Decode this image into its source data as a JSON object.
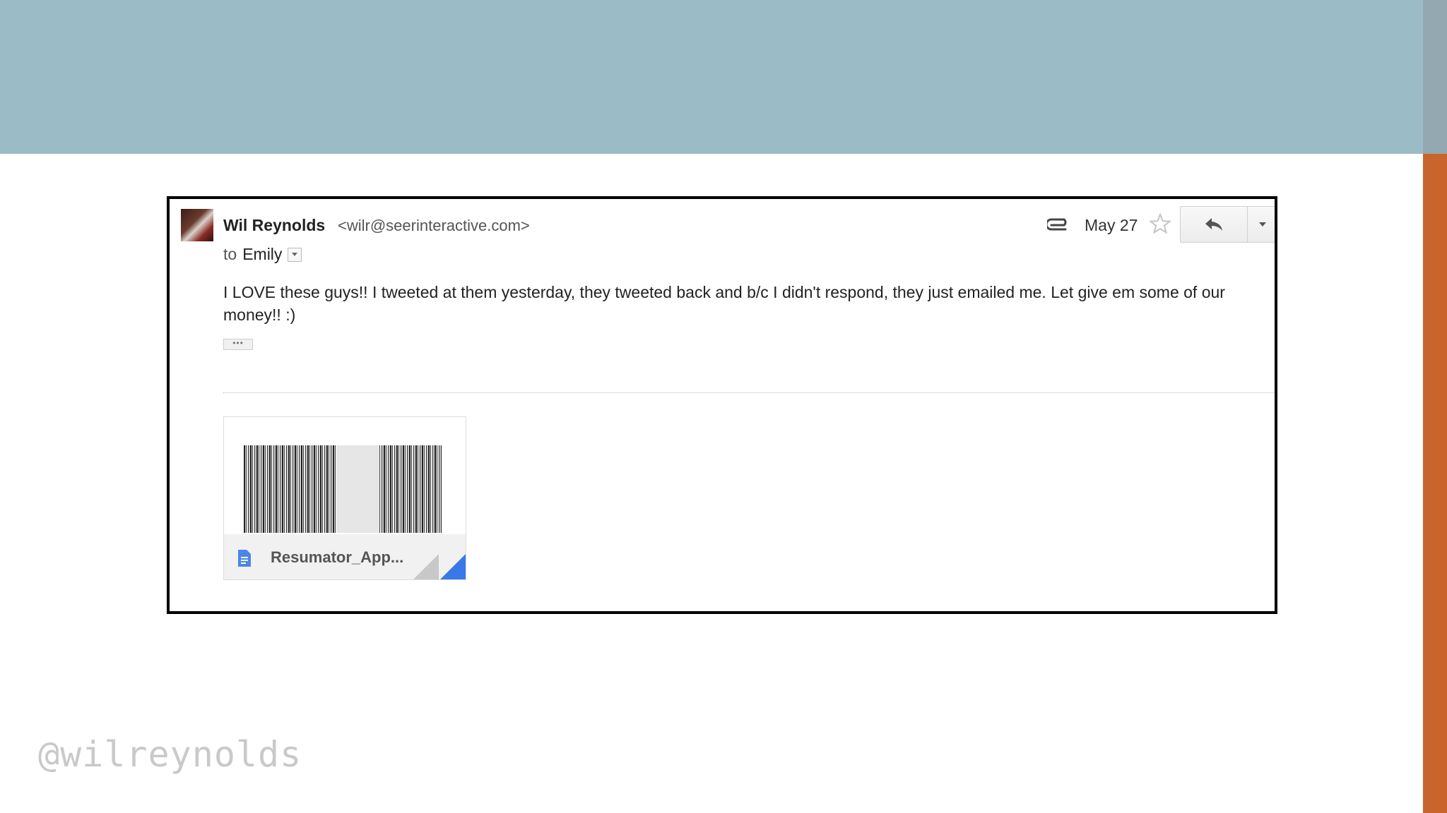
{
  "email": {
    "sender_name": "Wil Reynolds",
    "sender_email": "<wilr@seerinteractive.com>",
    "to_prefix": "to",
    "to_name": "Emily",
    "date": "May 27",
    "body": "I LOVE these guys!!  I tweeted at them yesterday, they tweeted back and b/c I didn't respond, they just emailed me.  Let give em some of our money!! :)",
    "ellipsis": "•••",
    "attachment": {
      "name": "Resumator_App...",
      "icon": "doc-icon"
    },
    "icons": [
      "paperclip-icon",
      "star-icon",
      "reply-icon",
      "chevron-down-icon"
    ]
  },
  "footer": {
    "handle": "@wilreynolds"
  },
  "colors": {
    "top_band": "#9bbbc6",
    "accent_strip": "#c9652c",
    "doc_icon": "#4a86e8",
    "corner_fold": "#3b78e7"
  }
}
